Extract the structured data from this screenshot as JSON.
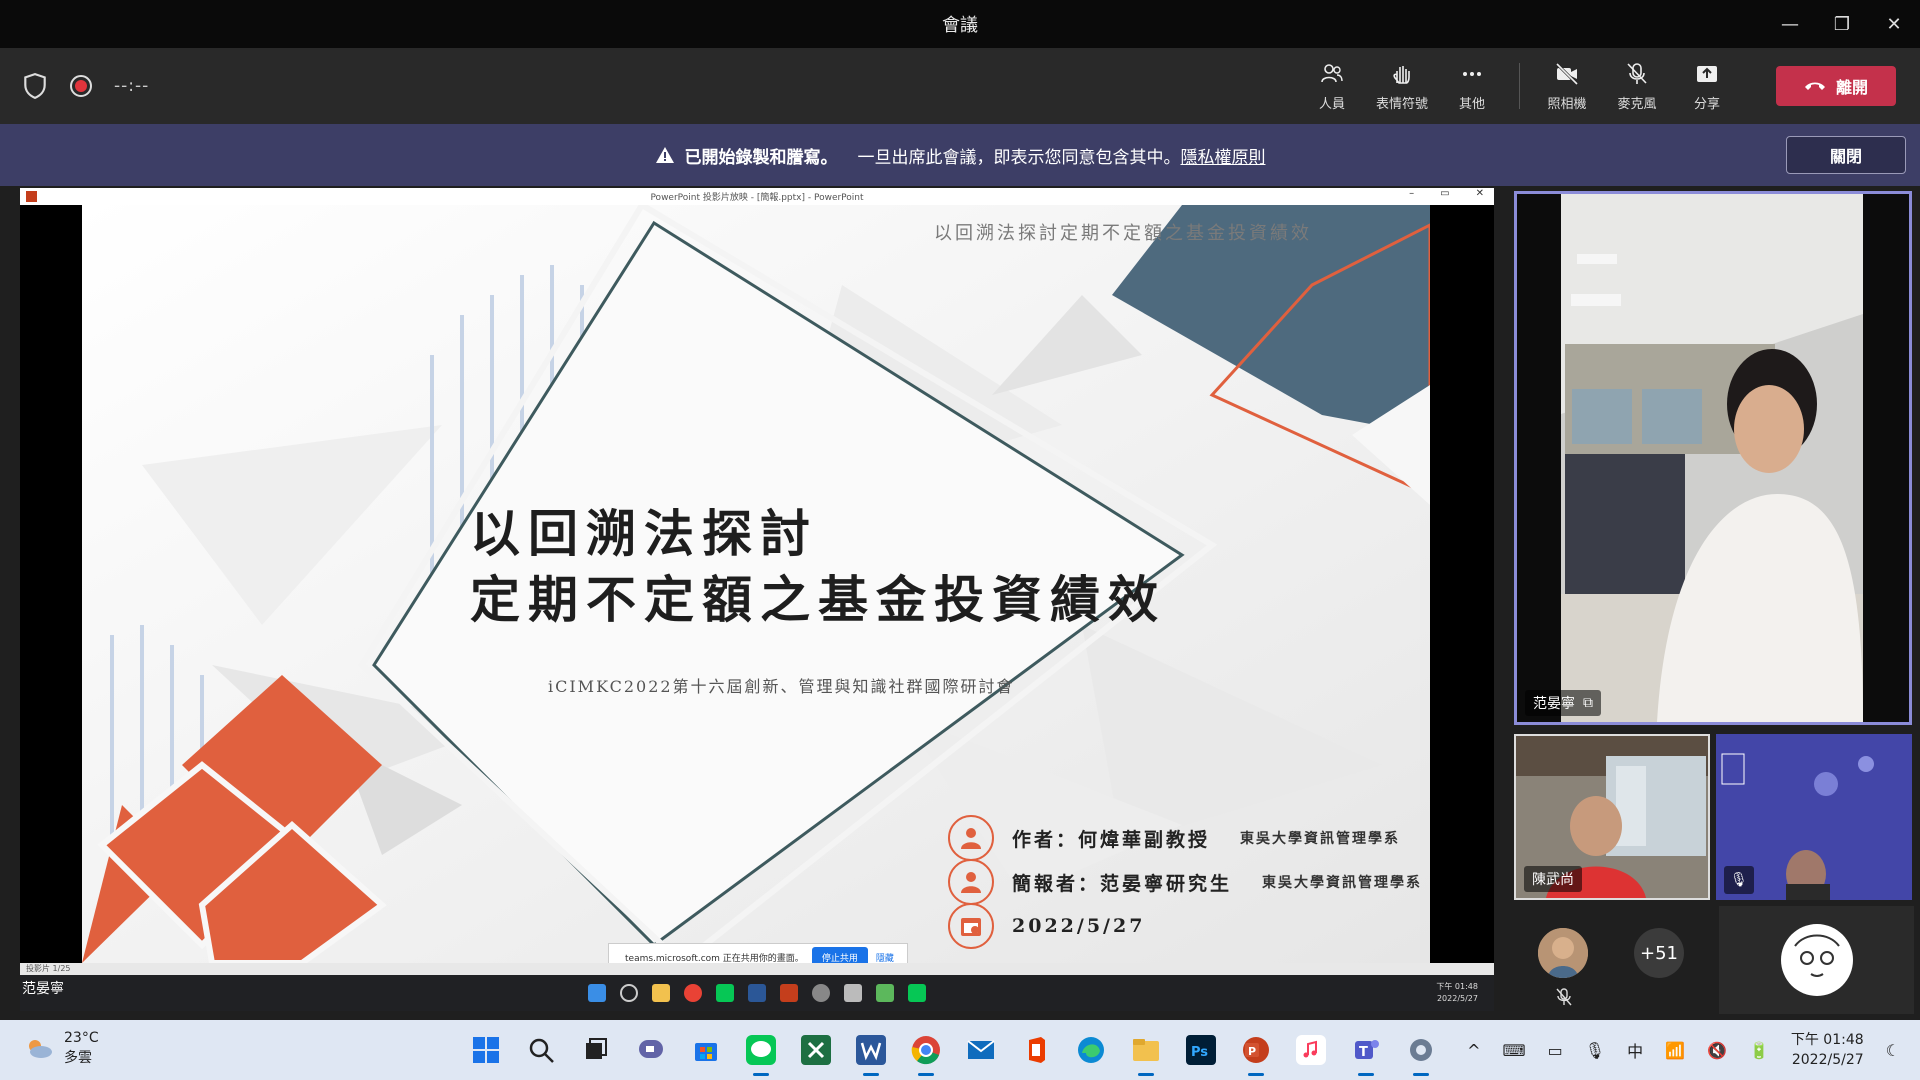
{
  "window": {
    "title": "會議"
  },
  "toolbar": {
    "timer": "--:--",
    "people_label": "人員",
    "reactions_label": "表情符號",
    "more_label": "其他",
    "camera_label": "照相機",
    "mic_label": "麥克風",
    "share_label": "分享",
    "leave_label": "離開"
  },
  "banner": {
    "strong": "已開始錄製和謄寫。",
    "text": "一旦出席此會議，即表示您同意包含其中。",
    "link": "隱私權原則",
    "close_label": "關閉"
  },
  "shared_screen": {
    "window_title": "PowerPoint 投影片放映 - [簡報.pptx] - PowerPoint",
    "slide_top_caption": "以回溯法探討定期不定額之基金投資績效",
    "slide_title_line1": "以回溯法探討",
    "slide_title_line2": "定期不定額之基金投資績效",
    "conference": "iCIMKC2022第十六屆創新、管理與知識社群國際研討會",
    "author": "作者：何煒華副教授",
    "author_dept": "東吳大學資訊管理學系",
    "presenter": "簡報者：范晏寧研究生",
    "presenter_dept": "東吳大學資訊管理學系",
    "date": "2022/5/27",
    "status_bar": "投影片 1/25",
    "sharebar_text": "teams.microsoft.com 正在共用你的畫面。",
    "sharebar_stop": "停止共用",
    "sharebar_hide": "隱藏",
    "inner_clock_time": "下午 01:48",
    "inner_clock_date": "2022/5/27",
    "presenter_tag": "范晏寧"
  },
  "participants": {
    "main_name": "范晏寧",
    "small1_name": "陳武尚",
    "more_count": "+51"
  },
  "taskbar": {
    "temp": "23°C",
    "weather": "多雲",
    "time": "下午 01:48",
    "date": "2022/5/27",
    "ime": "中"
  },
  "colors": {
    "accent_banner": "#3d3e66",
    "leave_red": "#c4314b",
    "slide_orange": "#e0603e",
    "slide_blue": "#4e6a7e"
  }
}
